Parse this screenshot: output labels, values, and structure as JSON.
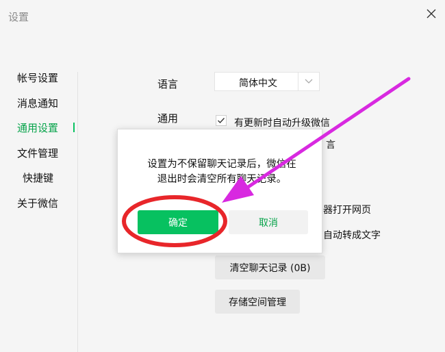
{
  "window": {
    "title": "设置"
  },
  "sidebar": {
    "items": [
      {
        "label": "帐号设置"
      },
      {
        "label": "消息通知"
      },
      {
        "label": "通用设置"
      },
      {
        "label": "文件管理"
      },
      {
        "label": "快捷键"
      },
      {
        "label": "关于微信"
      }
    ],
    "active_index": 2
  },
  "settings": {
    "language_label": "语言",
    "language_value": "简体中文",
    "general_label": "通用",
    "options": [
      {
        "text": "有更新时自动升级微信",
        "checked": true
      },
      {
        "text": "言",
        "checked": false
      },
      {
        "text": "器打开网页",
        "checked": false
      },
      {
        "text": "自动转成文字",
        "checked": false
      }
    ],
    "clear_history_button": "清空聊天记录 (0B)",
    "storage_button": "存储空间管理"
  },
  "dialog": {
    "message_line1": "设置为不保留聊天记录后，微信在",
    "message_line2": "退出时会清空所有聊天记录。",
    "confirm_label": "确定",
    "cancel_label": "取消"
  },
  "colors": {
    "accent": "#07c160",
    "annotation": "#e8262a",
    "arrow": "#d829e0"
  },
  "icons": [
    "close-icon",
    "chevron-down-icon",
    "checkmark-icon"
  ]
}
